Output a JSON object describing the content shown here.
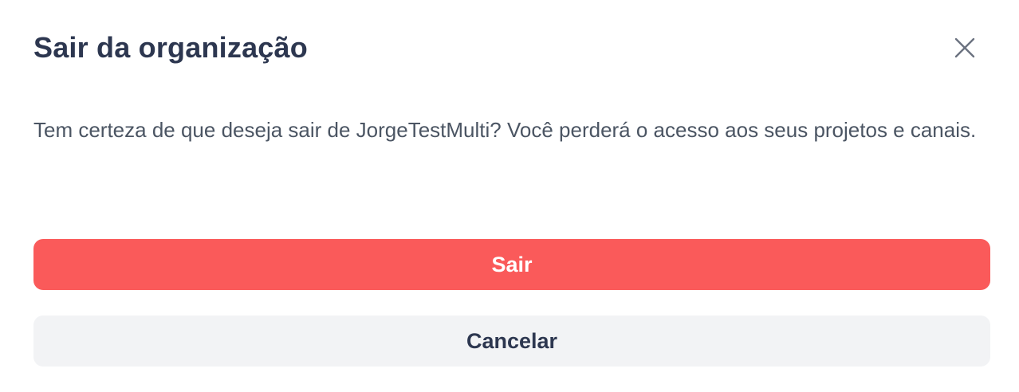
{
  "dialog": {
    "title": "Sair da organização",
    "close_icon": "close-icon",
    "message": "Tem certeza de que deseja sair de JorgeTestMulti? Você perderá o acesso aos seus projetos e canais.",
    "confirm_label": "Sair",
    "cancel_label": "Cancelar"
  },
  "colors": {
    "title": "#2d3750",
    "text": "#4b5563",
    "danger": "#fa5a5a",
    "secondary_bg": "#f2f3f5",
    "icon": "#6b7280"
  }
}
